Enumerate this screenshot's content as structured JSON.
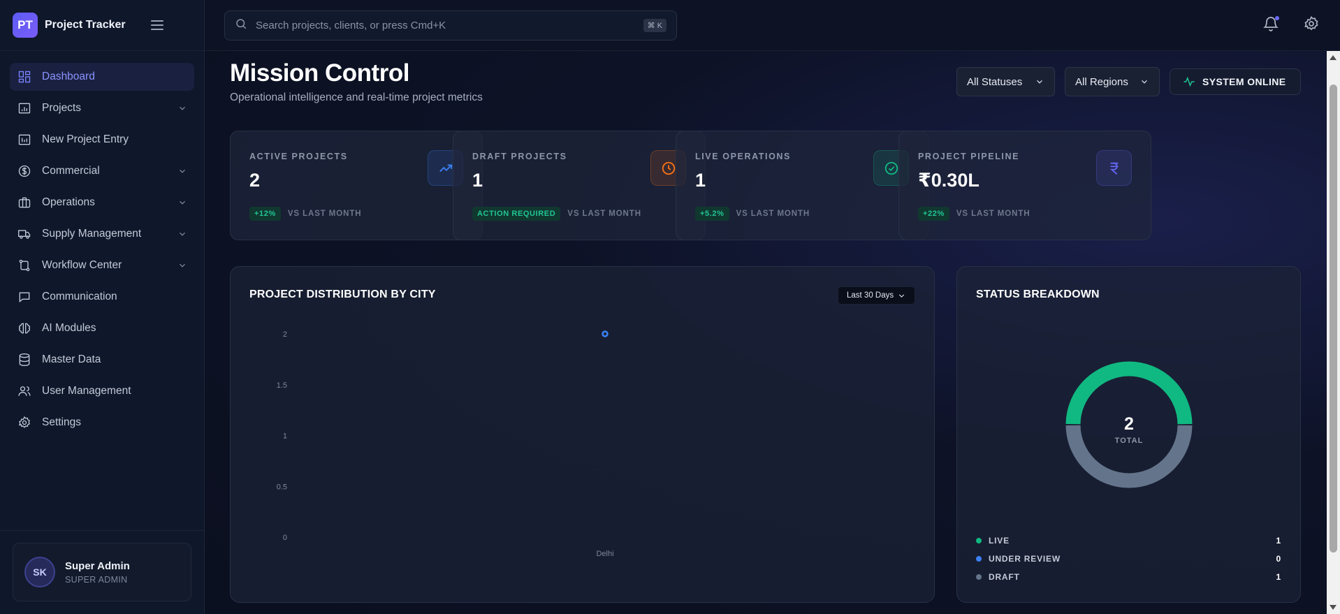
{
  "brand": {
    "logo_text": "PT",
    "name": "Project Tracker"
  },
  "search": {
    "placeholder": "Search projects, clients, or press Cmd+K",
    "shortcut": "⌘ K"
  },
  "sidebar": {
    "items": [
      {
        "label": "Dashboard",
        "icon": "dashboard-icon",
        "active": true,
        "has_children": false
      },
      {
        "label": "Projects",
        "icon": "projects-icon",
        "active": false,
        "has_children": true
      },
      {
        "label": "New Project Entry",
        "icon": "chart-icon",
        "active": false,
        "has_children": false
      },
      {
        "label": "Commercial",
        "icon": "dollar-icon",
        "active": false,
        "has_children": true
      },
      {
        "label": "Operations",
        "icon": "briefcase-icon",
        "active": false,
        "has_children": true
      },
      {
        "label": "Supply Management",
        "icon": "truck-icon",
        "active": false,
        "has_children": true
      },
      {
        "label": "Workflow Center",
        "icon": "workflow-icon",
        "active": false,
        "has_children": true
      },
      {
        "label": "Communication",
        "icon": "message-icon",
        "active": false,
        "has_children": false
      },
      {
        "label": "AI Modules",
        "icon": "brain-icon",
        "active": false,
        "has_children": false
      },
      {
        "label": "Master Data",
        "icon": "database-icon",
        "active": false,
        "has_children": false
      },
      {
        "label": "User Management",
        "icon": "users-icon",
        "active": false,
        "has_children": false
      },
      {
        "label": "Settings",
        "icon": "gear-icon",
        "active": false,
        "has_children": false
      }
    ]
  },
  "user": {
    "initials": "SK",
    "name": "Super Admin",
    "role": "SUPER ADMIN"
  },
  "header": {
    "title": "Mission Control",
    "subtitle": "Operational intelligence and real-time project metrics",
    "status_filter": "All Statuses",
    "region_filter": "All Regions",
    "system_status": "SYSTEM ONLINE"
  },
  "kpis": [
    {
      "label": "ACTIVE PROJECTS",
      "value": "2",
      "badge": "+12%",
      "compare": "VS LAST MONTH",
      "icon": "trending-up-icon",
      "accent": "#3b82f6"
    },
    {
      "label": "DRAFT PROJECTS",
      "value": "1",
      "badge": "ACTION REQUIRED",
      "compare": "VS LAST MONTH",
      "icon": "clock-icon",
      "accent": "#f97316"
    },
    {
      "label": "LIVE OPERATIONS",
      "value": "1",
      "badge": "+5.2%",
      "compare": "VS LAST MONTH",
      "icon": "check-circle-icon",
      "accent": "#10b981"
    },
    {
      "label": "PROJECT PIPELINE",
      "value": "₹0.30L",
      "badge": "+22%",
      "compare": "VS LAST MONTH",
      "icon": "rupee-icon",
      "accent": "#6366f1"
    }
  ],
  "distribution": {
    "title": "PROJECT DISTRIBUTION BY CITY",
    "range": "Last 30 Days"
  },
  "status_breakdown": {
    "title": "STATUS BREAKDOWN",
    "total_value": "2",
    "total_label": "TOTAL"
  },
  "chart_data": [
    {
      "type": "scatter",
      "categories": [
        "Delhi"
      ],
      "values": [
        2
      ],
      "title": "PROJECT DISTRIBUTION BY CITY",
      "ylim": [
        0,
        2
      ],
      "yticks": [
        "0",
        "0.5",
        "1",
        "1.5",
        "2"
      ],
      "color": "#3b82f6",
      "grid": false
    },
    {
      "type": "pie",
      "labels": [
        "LIVE",
        "UNDER REVIEW",
        "DRAFT"
      ],
      "values": [
        1,
        0,
        1
      ],
      "colors": [
        "#10b981",
        "#3b82f6",
        "#64748b"
      ]
    }
  ],
  "colors": {
    "accent": "#6366f1",
    "success": "#22c594"
  }
}
